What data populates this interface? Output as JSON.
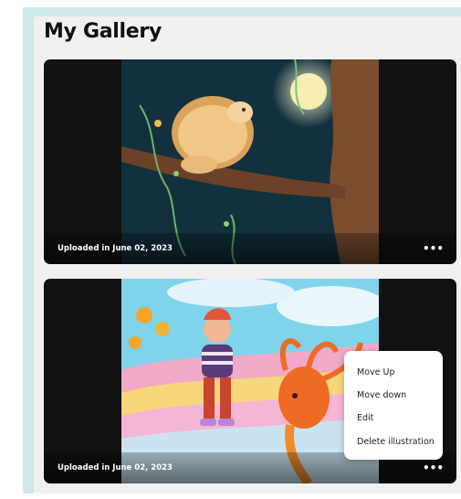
{
  "page": {
    "title": "My Gallery"
  },
  "gallery": {
    "items": [
      {
        "caption": "Uploaded in June 02, 2023",
        "more_icon": "more-horizontal-icon"
      },
      {
        "caption": "Uploaded in June 02, 2023",
        "more_icon": "more-horizontal-icon"
      }
    ]
  },
  "context_menu": {
    "items": [
      "Move Up",
      "Move down",
      "Edit",
      "Delete illustration"
    ]
  },
  "colors": {
    "frame": "#cde9ea",
    "panel": "#f0f0f0",
    "card": "#121212"
  }
}
